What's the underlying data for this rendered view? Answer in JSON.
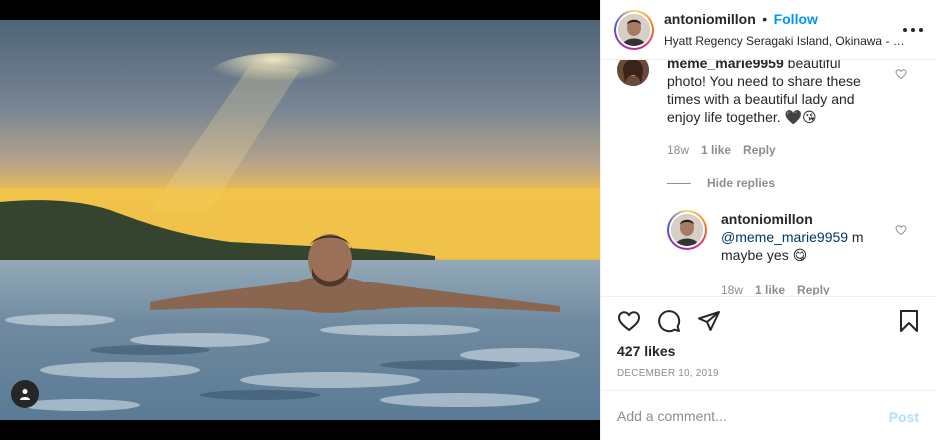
{
  "header": {
    "username": "antoniomillon",
    "separator": "•",
    "follow_label": "Follow",
    "location": "Hyatt Regency Seragaki Island, Okinawa - ハイアット リージェンシー 瀬良垣アイランド 沖縄"
  },
  "comments": [
    {
      "user": "meme_marie9959",
      "text": "beautiful photo! You need to share these times with a beautiful lady and enjoy life together. 🖤😘",
      "age": "18w",
      "likes": "1 like",
      "reply_label": "Reply"
    }
  ],
  "hide_replies_label": "Hide replies",
  "reply": {
    "user": "antoniomillon",
    "mention": "@meme_marie9959",
    "text": " m maybe yes 😋",
    "age": "18w",
    "likes": "1 like",
    "reply_label": "Reply"
  },
  "likes_count": "427 likes",
  "date": "December 10, 2019",
  "add_comment": {
    "placeholder": "Add a comment...",
    "post_label": "Post"
  },
  "icons": [
    "tag-user-icon",
    "more-options-icon",
    "heart-icon",
    "comment-icon",
    "share-icon",
    "bookmark-icon"
  ],
  "colors": {
    "follow": "#0095f6",
    "post_disabled": "#b2dffc",
    "muted": "#8e8e8e"
  }
}
